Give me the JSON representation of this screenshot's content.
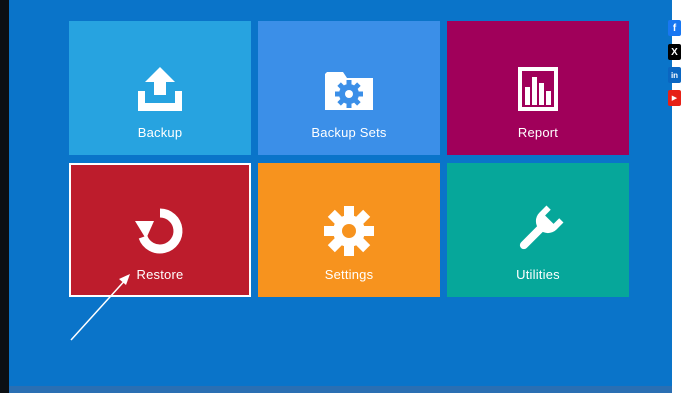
{
  "tiles": [
    {
      "id": "backup",
      "label": "Backup",
      "icon": "upload-tray-icon",
      "color": "#27a3e0"
    },
    {
      "id": "backup-sets",
      "label": "Backup Sets",
      "icon": "folder-gear-icon",
      "color": "#3b8fe8"
    },
    {
      "id": "report",
      "label": "Report",
      "icon": "bar-chart-icon",
      "color": "#a0005a"
    },
    {
      "id": "restore",
      "label": "Restore",
      "icon": "restore-arrow-icon",
      "color": "#bd1c2c",
      "selected": true
    },
    {
      "id": "settings",
      "label": "Settings",
      "icon": "gear-icon",
      "color": "#f7931e"
    },
    {
      "id": "utilities",
      "label": "Utilities",
      "icon": "wrench-icon",
      "color": "#06a79a"
    }
  ],
  "social": {
    "facebook": {
      "glyph": "f",
      "color": "#1877f2"
    },
    "x": {
      "glyph": "X",
      "color": "#000000"
    },
    "linkedin": {
      "glyph": "in",
      "color": "#0a66c2"
    },
    "youtube": {
      "glyph": "▶",
      "color": "#e62117"
    }
  },
  "colors": {
    "background": "#0a74c9",
    "arrow": "#ffffff"
  }
}
